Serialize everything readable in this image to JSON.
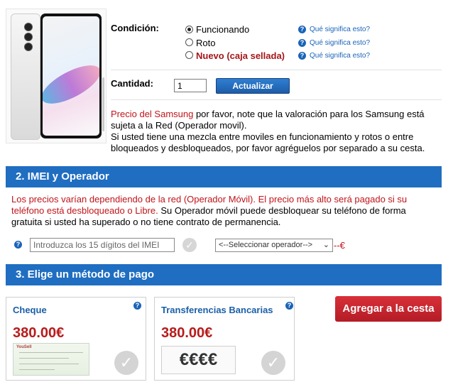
{
  "product": {
    "condition_label": "Condición:",
    "conditions": [
      {
        "label": "Funcionando",
        "selected": true
      },
      {
        "label": "Roto",
        "selected": false
      },
      {
        "label": "Nuevo (caja sellada)",
        "selected": false
      }
    ],
    "help_link": "Qué significa esto?",
    "quantity_label": "Cantidad:",
    "quantity_value": "1",
    "update_button": "Actualizar"
  },
  "info": {
    "price_prefix": "Precio del Samsung",
    "line1_rest": " por favor, note que la valoración para los Samsung está sujeta a la Red (Operador movil).",
    "line2": "Si usted tiene una mezcla entre moviles en funcionamiento y rotos o entre bloqueados y desbloqueados, por favor agréguelos por separado a su cesta."
  },
  "section2": {
    "title": "2. IMEI y Operador",
    "text_red": "Los precios varían dependiendo de la red (Operador Móvil). El precio más alto será pagado si su teléfono está desbloqueado o Libre.",
    "text_rest": " Su Operador móvil puede desbloquear su teléfono de forma gratuita si usted ha superado o no tiene contrato de permanencia.",
    "imei_placeholder": "Introduzca los 15 dígitos del IMEI",
    "operator_selected": "<--Seleccionar operador-->",
    "dash_euro": "--€"
  },
  "section3": {
    "title": "3. Elige un método de pago",
    "methods": [
      {
        "name": "Cheque",
        "price": "380.00€"
      },
      {
        "name": "Transferencias Bancarias",
        "price": "380.00€",
        "badge": "€€€€"
      }
    ],
    "cheque_logo": "YouSell"
  },
  "cart_button": "Agregar a la cesta",
  "colors": {
    "accent_blue": "#1f6ec1",
    "price_red": "#b81b1b",
    "cart_red": "#c8232d"
  },
  "icons": [
    "question-icon",
    "check-icon",
    "chevron-down-icon",
    "radio-icon"
  ]
}
